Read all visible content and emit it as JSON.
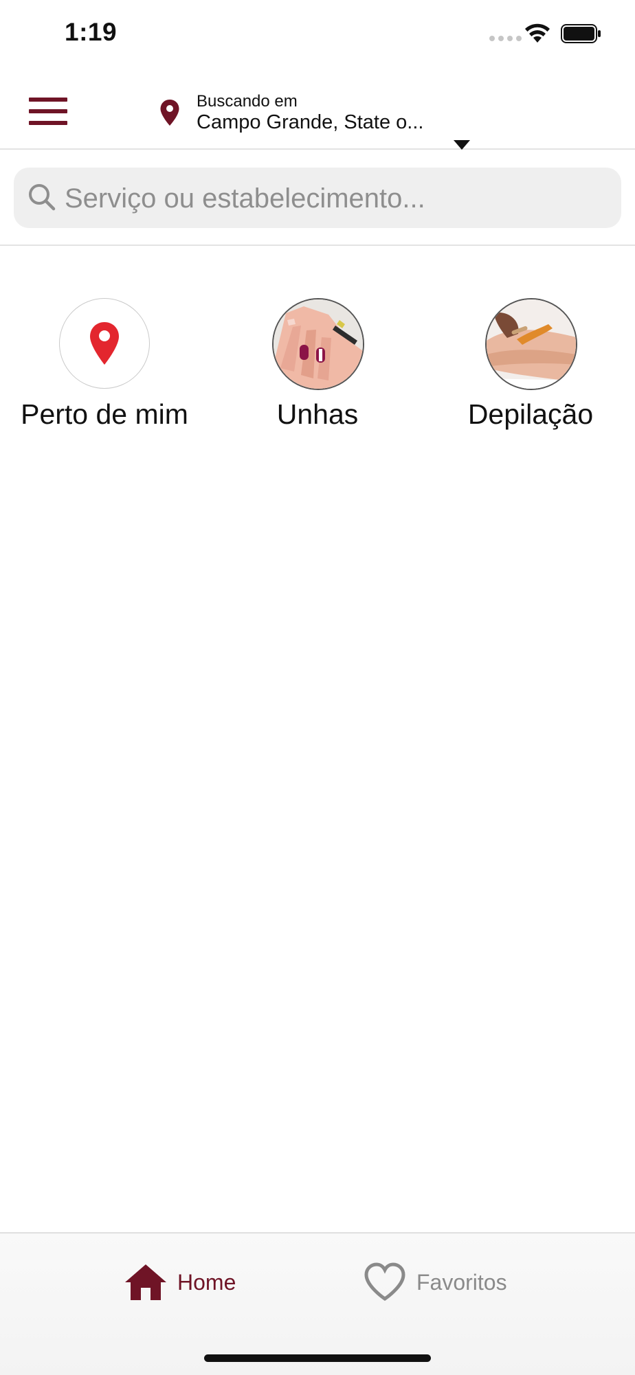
{
  "status_bar": {
    "time": "1:19"
  },
  "header": {
    "location_prefix": "Buscando em",
    "location_value": "Campo Grande, State o..."
  },
  "search": {
    "placeholder": "Serviço ou estabelecimento..."
  },
  "categories": [
    {
      "label": "Perto de mim",
      "icon": "map-pin-icon"
    },
    {
      "label": "Unhas",
      "icon": "nails-photo"
    },
    {
      "label": "Depilação",
      "icon": "waxing-photo"
    }
  ],
  "tabbar": {
    "home_label": "Home",
    "favorites_label": "Favoritos"
  },
  "colors": {
    "brand": "#6f1426",
    "pin_red": "#e3262e",
    "inactive": "#8a8a8a"
  }
}
